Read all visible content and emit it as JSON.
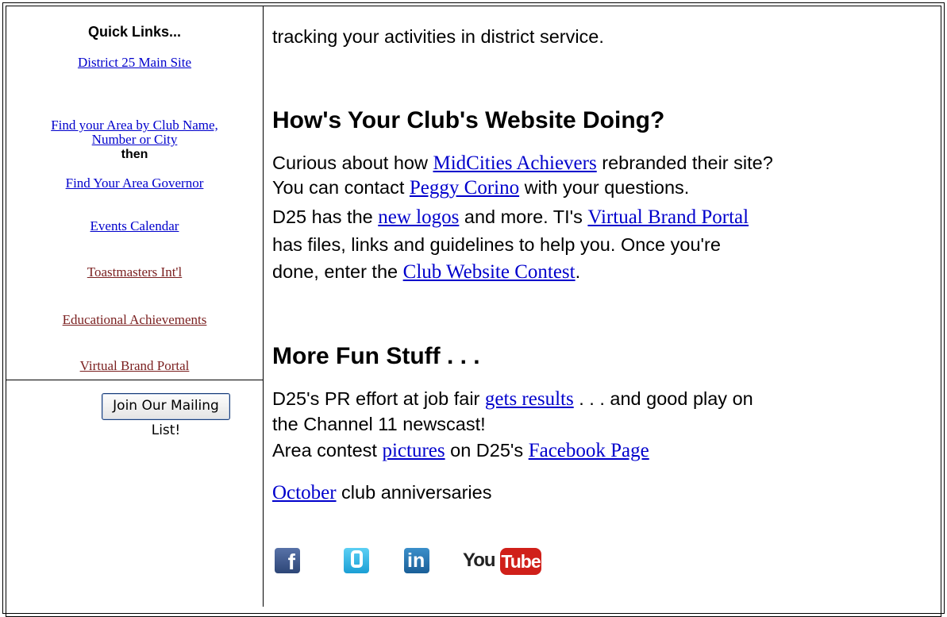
{
  "sidebar": {
    "title": "Quick Links...",
    "links": {
      "main_site": "District 25 Main Site",
      "find_area_1": "Find your Area by Club Name,",
      "find_area_2": "Number or City",
      "then": "then",
      "find_governor": "Find Your Area Governor",
      "events": "Events Calendar",
      "toastmasters": "Toastmasters Int'l ",
      "educational": "Educational Achievements",
      "virtual_brand": "Virtual Brand Portal"
    },
    "join_button": "Join Our Mailing List!"
  },
  "main": {
    "intro": "tracking your activities in district service.",
    "section1": {
      "heading": "How's Your Club's Website Doing?",
      "l1a": "Curious about how ",
      "l1link": "MidCities Achievers",
      "l1b": " rebranded their site?",
      "l2a": "You can contact ",
      "l2link": "Peggy Corino",
      "l2b": " with your questions.",
      "l3a": "D25 has the ",
      "l3link1": "new logos",
      "l3b": " and more. TI's ",
      "l3link2": "Virtual Brand Portal",
      "l4": "has files, links and guidelines to help you. Once you're",
      "l5a": "done, enter the ",
      "l5link": "Club Website Contest",
      "l5b": "."
    },
    "section2": {
      "heading": "More Fun Stuff . . .",
      "l1a": "D25's PR effort at job fair ",
      "l1link": "gets results",
      "l1b": " . . . and good play on",
      "l2": "the Channel 11 newscast!",
      "l3a": "Area contest ",
      "l3link1": "pictures",
      "l3b": " on D25's ",
      "l3link2": "Facebook Page",
      "l4link": "October",
      "l4b": " club anniversaries"
    },
    "social": {
      "facebook": "f",
      "youtube_you": "You",
      "youtube_tube": "Tube",
      "linkedin": "in"
    }
  }
}
